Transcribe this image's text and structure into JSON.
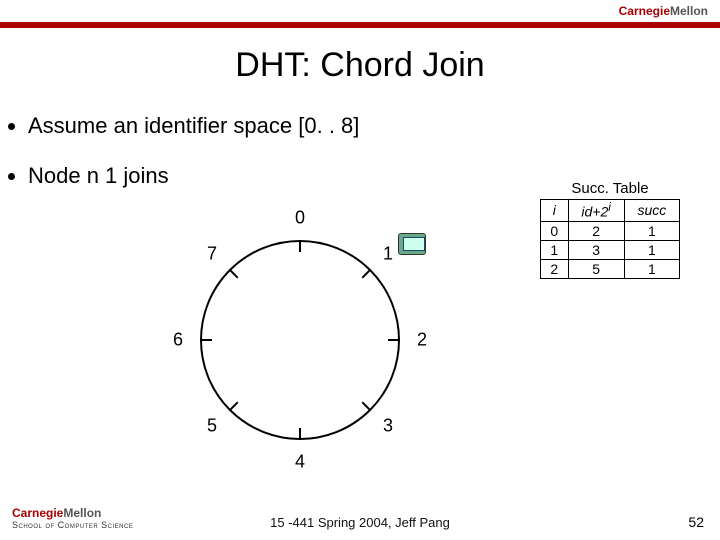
{
  "header": {
    "wordmark_left": "Carnegie",
    "wordmark_right": "Mellon"
  },
  "title": "DHT: Chord Join",
  "bullets": [
    "Assume an identifier space [0. . 8]",
    "Node n 1 joins"
  ],
  "ring": {
    "labels": [
      "0",
      "1",
      "2",
      "3",
      "4",
      "5",
      "6",
      "7"
    ],
    "active_node": 1
  },
  "succ": {
    "title": "Succ. Table",
    "headers": [
      "i",
      "id+2",
      "succ"
    ],
    "id_col_sup": "i",
    "rows": [
      [
        "0",
        "2",
        "1"
      ],
      [
        "1",
        "3",
        "1"
      ],
      [
        "2",
        "5",
        "1"
      ]
    ]
  },
  "footer": {
    "course": "15 -441 Spring 2004, Jeff Pang",
    "school": "School of Computer Science",
    "page": "52"
  }
}
